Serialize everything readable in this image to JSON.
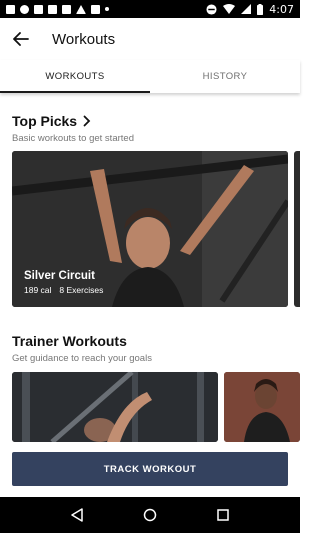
{
  "status_bar": {
    "time": "4:07"
  },
  "app_bar": {
    "title": "Workouts"
  },
  "tabs": [
    {
      "label": "WORKOUTS",
      "active": true
    },
    {
      "label": "HISTORY",
      "active": false
    }
  ],
  "top_picks": {
    "title": "Top Picks",
    "subtitle": "Basic workouts to get started",
    "cards": [
      {
        "title": "Silver Circuit",
        "calories": "189 cal",
        "exercises": "8 Exercises"
      }
    ]
  },
  "trainer_workouts": {
    "title": "Trainer Workouts",
    "subtitle": "Get guidance to reach your goals"
  },
  "actions": {
    "track_workout": "TRACK WORKOUT"
  },
  "colors": {
    "cta_background": "#34425f",
    "active_tab_indicator": "#1b1b1b"
  }
}
